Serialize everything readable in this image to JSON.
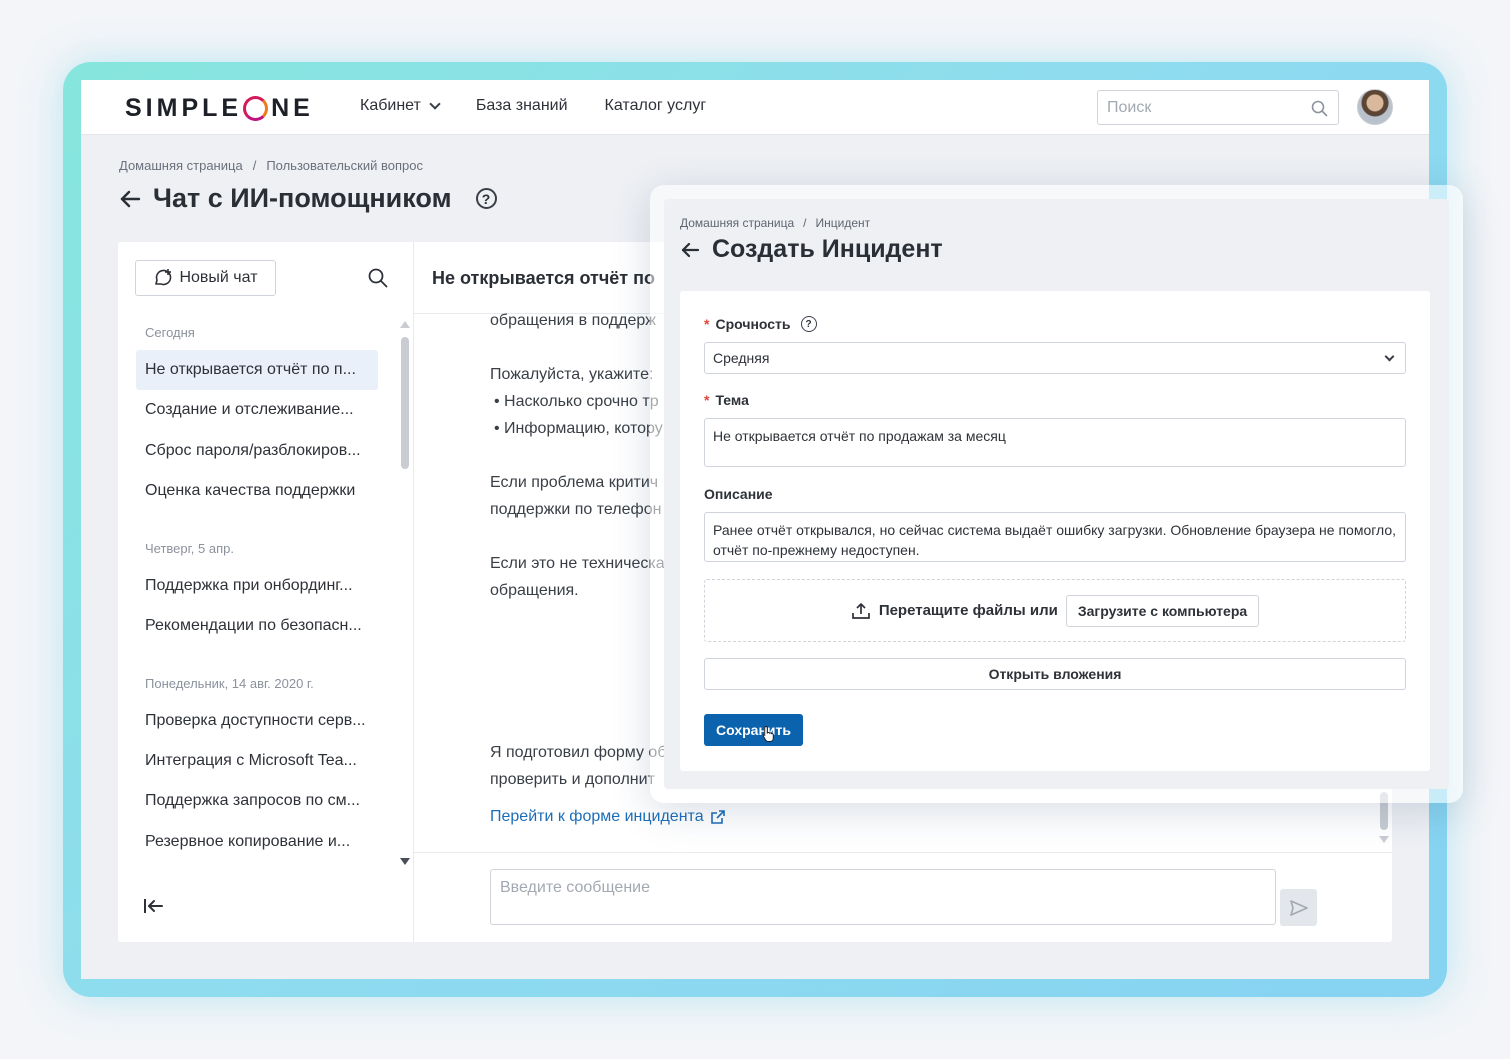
{
  "header": {
    "logo_left": "SIMPLE",
    "logo_right": "NE",
    "nav": [
      {
        "label": "Кабинет"
      },
      {
        "label": "База знаний"
      },
      {
        "label": "Каталог услуг"
      }
    ],
    "search_placeholder": "Поиск"
  },
  "page": {
    "breadcrumbs": [
      "Домашняя страница",
      "/",
      "Пользовательский вопрос"
    ],
    "title": "Чат с ИИ-помощником"
  },
  "sidebar": {
    "new_chat_label": "Новый чат",
    "groups": [
      {
        "label": "Сегодня",
        "items": [
          "Не открывается отчёт по п...",
          "Создание и отслеживание...",
          "Сброс пароля/разблокиров...",
          "Оценка качества поддержки"
        ]
      },
      {
        "label": "Четверг, 5 апр.",
        "items": [
          "Поддержка при онбординг...",
          "Рекомендации по безопасн..."
        ]
      },
      {
        "label": "Понедельник, 14 авг. 2020 г.",
        "items": [
          "Проверка доступности серв...",
          "Интеграция с Microsoft Tea...",
          "Поддержка запросов по см...",
          "Резервное копирование и..."
        ]
      }
    ]
  },
  "chat": {
    "title": "Не открывается отчёт по",
    "messages": [
      "обращения в поддерж",
      "Пожалуйста, укажите:",
      "• Насколько срочно тр",
      "• Информацию, котору",
      "Если проблема критич",
      "поддержки по телефон",
      "Если это не техническа",
      "обращения.",
      "Я подготовил форму об",
      "проверить и дополнит"
    ],
    "incident_link": "Перейти к форме инцидента",
    "composer_placeholder": "Введите сообщение"
  },
  "incident": {
    "breadcrumbs": [
      "Домашняя страница",
      "/",
      "Инцидент"
    ],
    "title": "Создать Инцидент",
    "urgency_label": "Срочность",
    "urgency_value": "Средняя",
    "topic_label": "Тема",
    "topic_value": "Не открывается отчёт по продажам за месяц",
    "description_label": "Описание",
    "description_value": "Ранее отчёт открывался, но сейчас система выдаёт ошибку загрузки. Обновление браузера не помогло, отчёт по-прежнему недоступен.",
    "dropzone_text": "Перетащите файлы или",
    "upload_label": "Загрузите с компьютера",
    "open_attachments_label": "Открыть вложения",
    "save_label": "Сохранить"
  },
  "colors": {
    "accent": "#0c63ad",
    "link": "#1c6db9",
    "required": "#e1463a",
    "frame": "#8fdcef"
  },
  "icons": [
    "chevron-down-icon",
    "search-icon",
    "new-chat-icon",
    "back-arrow-icon",
    "help-icon",
    "collapse-sidebar-icon",
    "external-link-icon",
    "send-icon",
    "upload-icon",
    "hand-cursor-icon"
  ]
}
